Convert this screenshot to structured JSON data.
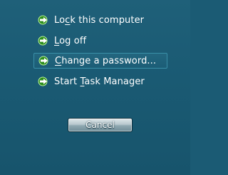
{
  "menu": {
    "items": [
      {
        "name": "lock-this-computer",
        "pre": "Lo",
        "accel": "c",
        "post": "k this computer",
        "selected": false
      },
      {
        "name": "log-off",
        "pre": "",
        "accel": "L",
        "post": "og off",
        "selected": false
      },
      {
        "name": "change-a-password",
        "pre": "",
        "accel": "C",
        "post": "hange a password...",
        "selected": true
      },
      {
        "name": "start-task-manager",
        "pre": "Start ",
        "accel": "T",
        "post": "ask Manager",
        "selected": false
      }
    ],
    "icon": "green-arrow-icon"
  },
  "cancel": {
    "label": "Cancel"
  },
  "colors": {
    "background": "#1b5b74",
    "arrow_green": "#5fc23a",
    "selection_border": "#3a8fa8",
    "text": "#ffffff"
  }
}
